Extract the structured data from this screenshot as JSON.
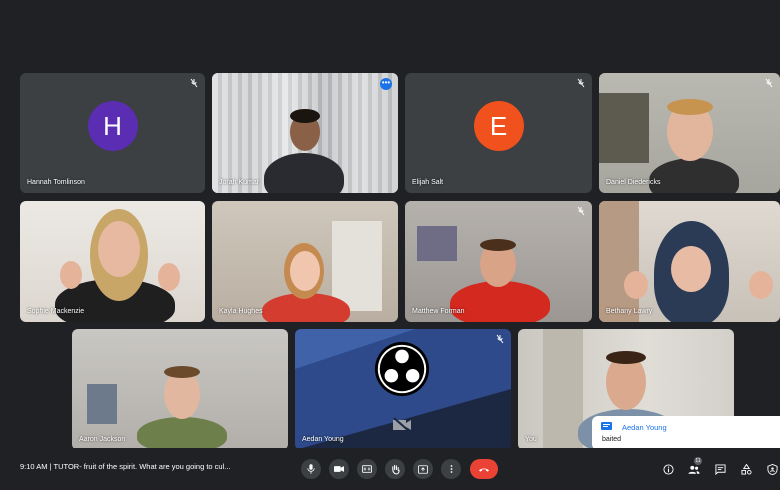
{
  "participants": [
    {
      "name": "Hannah Tomlinson",
      "initial": "H",
      "avatar_color": "#5b2db3",
      "muted": true
    },
    {
      "name": "Jorah Kumar",
      "muted": false,
      "active": true
    },
    {
      "name": "Elijah Salt",
      "initial": "E",
      "avatar_color": "#f0511d",
      "muted": true
    },
    {
      "name": "Daniel Diedericks",
      "muted": true
    },
    {
      "name": "Sophie Mackenzie",
      "muted": false
    },
    {
      "name": "Kayla Hughes",
      "muted": false
    },
    {
      "name": "Matthew Forman",
      "muted": true
    },
    {
      "name": "Bethany Lawry",
      "muted": false
    },
    {
      "name": "Aaron Jackson",
      "muted": false
    },
    {
      "name": "Aedan Young",
      "muted": true,
      "camera_off": true
    },
    {
      "name": "You",
      "muted": false
    }
  ],
  "bottom_bar": {
    "meeting_info": "9:10 AM  |  TUTOR- fruit of the spirit. What are you going to cul...",
    "participant_count": "11"
  },
  "notification": {
    "sender": "Aedan Young",
    "message": "baited"
  },
  "colors": {
    "background": "#202124",
    "tile": "#3c4043",
    "active_border": "#8ab4f8",
    "hangup": "#ea4335",
    "accent": "#1a73e8"
  }
}
